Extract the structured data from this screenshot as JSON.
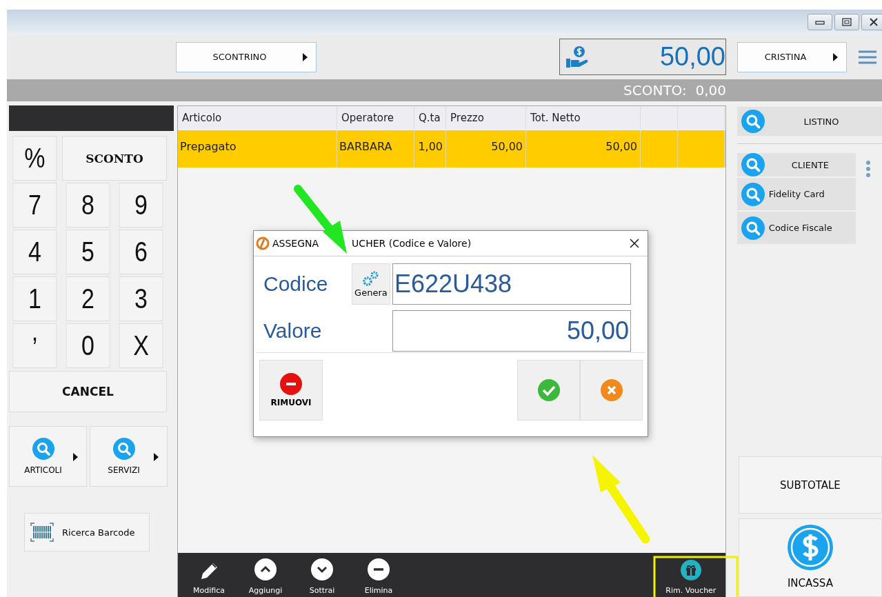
{
  "toolbar": {
    "document_type": {
      "label": "SCONTRINO"
    },
    "total": "50,00",
    "operator": {
      "label": "CRISTINA"
    }
  },
  "discount_bar": {
    "label": "SCONTO:",
    "value": "0,00"
  },
  "keypad": {
    "keys": [
      {
        "label": "%",
        "kind": "symbol"
      },
      {
        "label": "SCONTO",
        "kind": "wide"
      },
      {
        "label": "7",
        "kind": "digit"
      },
      {
        "label": "8",
        "kind": "digit"
      },
      {
        "label": "9",
        "kind": "digit"
      },
      {
        "label": "4",
        "kind": "digit"
      },
      {
        "label": "5",
        "kind": "digit"
      },
      {
        "label": "6",
        "kind": "digit"
      },
      {
        "label": "1",
        "kind": "digit"
      },
      {
        "label": "2",
        "kind": "digit"
      },
      {
        "label": "3",
        "kind": "digit"
      },
      {
        "label": ",",
        "kind": "comma"
      },
      {
        "label": "0",
        "kind": "digit"
      },
      {
        "label": "X",
        "kind": "digit"
      }
    ],
    "cancel": "CANCEL"
  },
  "catalog_buttons": [
    {
      "label": "ARTICOLI"
    },
    {
      "label": "SERVIZI"
    }
  ],
  "barcode_button": "Ricerca Barcode",
  "table": {
    "columns": [
      "Articolo",
      "Operatore",
      "Q.ta",
      "Prezzo",
      "Tot. Netto"
    ],
    "rows": [
      {
        "selected": true,
        "cells": [
          "Prepagato",
          "BARBARA",
          "1,00",
          "50,00",
          "50,00"
        ]
      }
    ]
  },
  "actions": [
    {
      "label": "Modifica",
      "kind": "edit"
    },
    {
      "label": "Aggiungi",
      "kind": "up"
    },
    {
      "label": "Sottrai",
      "kind": "down"
    },
    {
      "label": "Elimina",
      "kind": "remove"
    },
    {
      "label": "Rim. Voucher",
      "kind": "gift"
    }
  ],
  "side_panel": {
    "price_list": "LISTINO",
    "lookups": [
      {
        "label": "CLIENTE",
        "kind": "main"
      },
      {
        "label": "Fidelity Card",
        "kind": "sub"
      },
      {
        "label": "Codice Fiscale",
        "kind": "sub"
      }
    ],
    "subtotal": "SUBTOTALE",
    "checkout": "INCASSA"
  },
  "dialog": {
    "title_parts": [
      "ASSEGNA",
      "UCHER (Codice e Valore)"
    ],
    "code_label": "Codice",
    "generate_button": "Genera",
    "code_value": "E622U438",
    "value_label": "Valore",
    "value": "50,00",
    "remove_button": "RIMUOVI"
  }
}
